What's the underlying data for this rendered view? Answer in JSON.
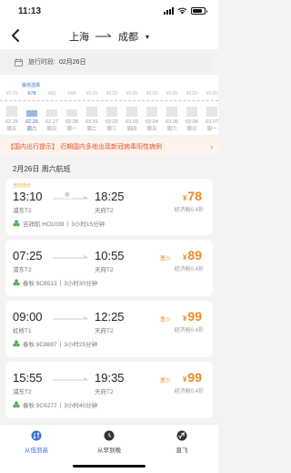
{
  "status": {
    "time": "11:13",
    "battery": 0.8
  },
  "nav": {
    "from": "上海",
    "to": "成都",
    "caret": "▾"
  },
  "datebar": {
    "label": "旅行时段:",
    "value": "02月26日"
  },
  "price_calendar": {
    "lowest_label": "最低选择",
    "selected_index": 1,
    "columns": [
      {
        "price": "¥170",
        "date": "02.25",
        "weekday": "周五",
        "level": 0.92
      },
      {
        "price": "¥78",
        "date": "02.26",
        "weekday": "周六",
        "level": 0.55
      },
      {
        "price": "¥80",
        "date": "02.27",
        "weekday": "周日",
        "level": 0.57
      },
      {
        "price": "¥88",
        "date": "02.28",
        "weekday": "周一",
        "level": 0.6
      },
      {
        "price": "¥120",
        "date": "03.01",
        "weekday": "周二",
        "level": 0.78
      },
      {
        "price": "¥120",
        "date": "03.02",
        "weekday": "周三",
        "level": 0.78
      },
      {
        "price": "¥120",
        "date": "03.03",
        "weekday": "周四",
        "level": 0.78
      },
      {
        "price": "¥120",
        "date": "03.04",
        "weekday": "周五",
        "level": 0.78
      },
      {
        "price": "¥120",
        "date": "03.05",
        "weekday": "周六",
        "level": 0.78
      },
      {
        "price": "¥120",
        "date": "03.06",
        "weekday": "周日",
        "level": 0.78
      },
      {
        "price": "¥120",
        "date": "03.07",
        "weekday": "周一",
        "level": 0.78
      }
    ]
  },
  "notice": {
    "text": "【国内出行提示】 近期国内多地出现新冠病毒阳性病例",
    "chevron": "›"
  },
  "day_title": "2月26日 周六航班",
  "flights": [
    {
      "tag": "当日低价",
      "dep_time": "13:10",
      "arr_time": "18:25",
      "dep_airport": "浦东T2",
      "arr_airport": "天府T2",
      "stop": "停",
      "airline": "吉祥航 HO1039",
      "duration": "3小时15分钟",
      "price": "78",
      "cabin": "经济舱0.4折",
      "low_flag": ""
    },
    {
      "tag": "",
      "dep_time": "07:25",
      "arr_time": "10:55",
      "dep_airport": "浦东T2",
      "arr_airport": "天府T2",
      "stop": "",
      "airline": "春秋 9C6513",
      "duration": "3小时30分钟",
      "price": "89",
      "cabin": "经济舱0.4折",
      "low_flag": "票少"
    },
    {
      "tag": "",
      "dep_time": "09:00",
      "arr_time": "12:25",
      "dep_airport": "虹桥T1",
      "arr_airport": "天府T2",
      "stop": "",
      "airline": "春秋 9C8887",
      "duration": "3小时25分钟",
      "price": "99",
      "cabin": "经济舱0.4折",
      "low_flag": "票少"
    },
    {
      "tag": "",
      "dep_time": "15:55",
      "arr_time": "19:35",
      "dep_airport": "浦东T2",
      "arr_airport": "天府T2",
      "stop": "",
      "airline": "春秋 9C6277",
      "duration": "3小时40分钟",
      "price": "99",
      "cabin": "经济舱0.4折",
      "low_flag": "票少"
    }
  ],
  "tabs": [
    {
      "label": "从低到高",
      "icon": "sort-icon"
    },
    {
      "label": "从早到晚",
      "icon": "clock-icon"
    },
    {
      "label": "直飞",
      "icon": "plane-icon"
    }
  ],
  "colors": {
    "accent": "#3a6fd1",
    "price": "#f08a24",
    "notice": "#e0572c"
  }
}
